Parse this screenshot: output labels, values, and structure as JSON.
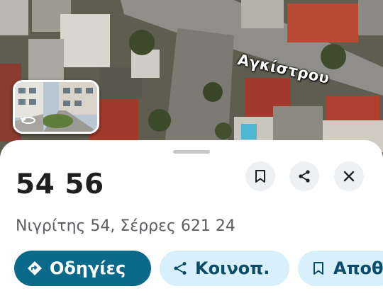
{
  "map": {
    "street_label": "Αγκίστρου"
  },
  "place": {
    "title": "54 56",
    "address": "Νιγρίτης 54, Σέρρες 621 24"
  },
  "actions": {
    "directions_label": "Οδηγίες",
    "share_label": "Κοινοπ.",
    "save_label": "Αποθ"
  },
  "colors": {
    "primary_chip": "#0b6a8a",
    "secondary_chip": "#d8f0fb",
    "round_button_bg": "#eef1f4"
  }
}
